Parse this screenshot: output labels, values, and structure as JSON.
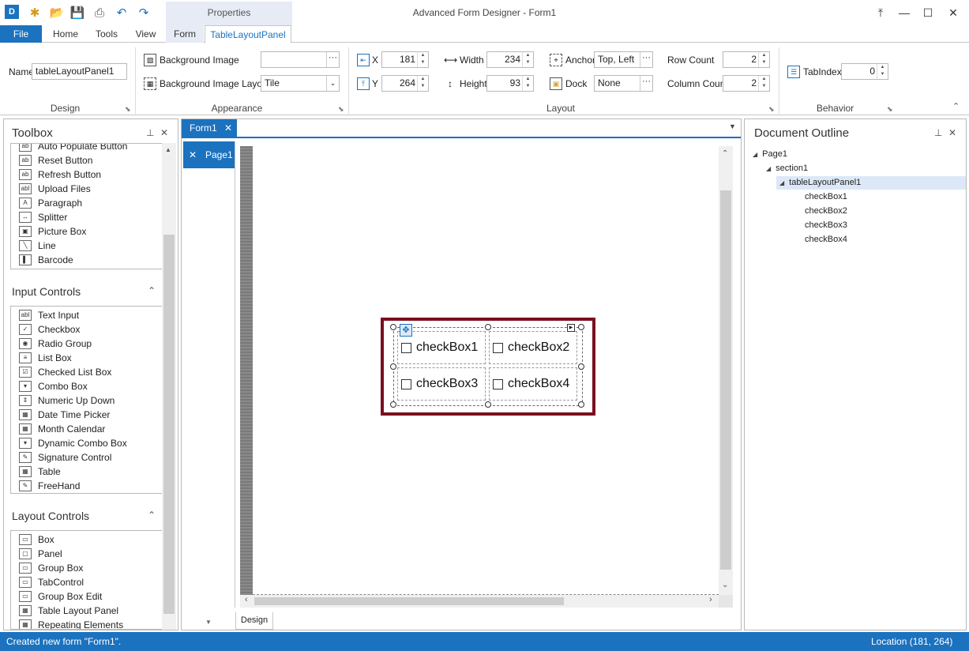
{
  "app_title": "Advanced Form Designer - Form1",
  "context_header": "Properties",
  "ribbon_tabs": {
    "file": "File",
    "home": "Home",
    "tools": "Tools",
    "view": "View",
    "form": "Form",
    "tlp": "TableLayoutPanel"
  },
  "ribbon": {
    "design": {
      "name_label": "Name",
      "name_value": "tableLayoutPanel1",
      "group": "Design"
    },
    "appearance": {
      "bg_image_label": "Background Image",
      "bg_image_value": "",
      "bg_layout_label": "Background Image Layout",
      "bg_layout_value": "Tile",
      "group": "Appearance"
    },
    "layout": {
      "x_label": "X",
      "x_value": "181",
      "y_label": "Y",
      "y_value": "264",
      "width_label": "Width",
      "width_value": "234",
      "height_label": "Height",
      "height_value": "93",
      "anchor_label": "Anchor",
      "anchor_value": "Top, Left",
      "dock_label": "Dock",
      "dock_value": "None",
      "row_count_label": "Row Count",
      "row_count_value": "2",
      "col_count_label": "Column Count",
      "col_count_value": "2",
      "group": "Layout"
    },
    "behavior": {
      "tabindex_label": "TabIndex",
      "tabindex_value": "0",
      "group": "Behavior"
    }
  },
  "toolbox": {
    "title": "Toolbox",
    "top_items": [
      {
        "icon": "ab",
        "label": "Auto Populate Button"
      },
      {
        "icon": "ab",
        "label": "Reset Button"
      },
      {
        "icon": "ab",
        "label": "Refresh Button"
      },
      {
        "icon": "abl",
        "label": "Upload Files"
      },
      {
        "icon": "A",
        "label": "Paragraph"
      },
      {
        "icon": "↔",
        "label": "Splitter"
      },
      {
        "icon": "▣",
        "label": "Picture Box"
      },
      {
        "icon": "╲",
        "label": "Line"
      },
      {
        "icon": "▌",
        "label": "Barcode"
      }
    ],
    "input_title": "Input Controls",
    "input_items": [
      "Text Input",
      "Checkbox",
      "Radio Group",
      "List Box",
      "Checked List Box",
      "Combo Box",
      "Numeric Up Down",
      "Date Time Picker",
      "Month Calendar",
      "Dynamic Combo Box",
      "Signature Control",
      "Table",
      "FreeHand"
    ],
    "layout_title": "Layout Controls",
    "layout_items": [
      "Box",
      "Panel",
      "Group Box",
      "TabControl",
      "Group Box Edit",
      "Table Layout Panel",
      "Repeating Elements"
    ]
  },
  "doc_tab": "Form1",
  "page_tab": "Page1",
  "design_tab": "Design",
  "checkboxes": [
    "checkBox1",
    "checkBox2",
    "checkBox3",
    "checkBox4"
  ],
  "outline": {
    "title": "Document Outline",
    "page": "Page1",
    "section": "section1",
    "panel": "tableLayoutPanel1",
    "children": [
      "checkBox1",
      "checkBox2",
      "checkBox3",
      "checkBox4"
    ]
  },
  "status": {
    "left": "Created new form \"Form1\".",
    "right": "Location (181, 264)"
  },
  "colors": {
    "accent": "#1b72bf",
    "selection_border": "#7a0f1f"
  }
}
